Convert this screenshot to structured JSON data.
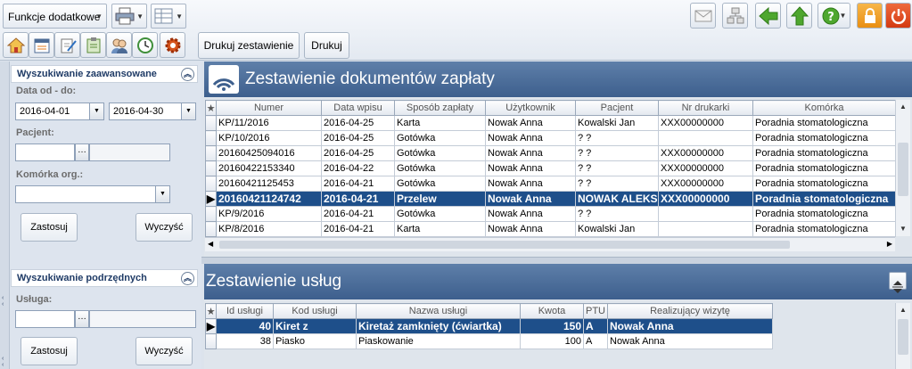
{
  "toolbar": {
    "functions_label": "Funkcje dodatkowe",
    "print_summary_label": "Drukuj zestawienie",
    "print_label": "Drukuj",
    "colors": {
      "green": "#4ea72e",
      "orange": "#f2a01c",
      "red": "#e0451f"
    }
  },
  "left": {
    "advanced_search": {
      "title": "Wyszukiwanie zaawansowane",
      "date_label": "Data od - do:",
      "date_from": "2016-04-01",
      "date_to": "2016-04-30",
      "patient_label": "Pacjent:",
      "patient_value": "",
      "unit_label": "Komórka org.:",
      "unit_value": "",
      "apply_label": "Zastosuj",
      "clear_label": "Wyczyść"
    },
    "sub_search": {
      "title": "Wyszukiwanie podrzędnych",
      "service_label": "Usługa:",
      "service_value": "",
      "apply_label": "Zastosuj",
      "clear_label": "Wyczyść"
    }
  },
  "payments": {
    "title": "Zestawienie dokumentów zapłaty",
    "columns": [
      "Numer",
      "Data wpisu",
      "Sposób zapłaty",
      "Użytkownik",
      "Pacjent",
      "Nr drukarki",
      "Komórka"
    ],
    "rows": [
      [
        "KP/11/2016",
        "2016-04-25",
        "Karta",
        "Nowak Anna",
        "Kowalski Jan",
        "XXX00000000",
        "Poradnia stomatologiczna"
      ],
      [
        "KP/10/2016",
        "2016-04-25",
        "Gotówka",
        "Nowak Anna",
        "? ?",
        "",
        "Poradnia stomatologiczna"
      ],
      [
        "20160425094016",
        "2016-04-25",
        "Gotówka",
        "Nowak Anna",
        "? ?",
        "XXX00000000",
        "Poradnia stomatologiczna"
      ],
      [
        "20160422153340",
        "2016-04-22",
        "Gotówka",
        "Nowak Anna",
        "? ?",
        "XXX00000000",
        "Poradnia stomatologiczna"
      ],
      [
        "20160421125453",
        "2016-04-21",
        "Gotówka",
        "Nowak Anna",
        "? ?",
        "XXX00000000",
        "Poradnia stomatologiczna"
      ],
      [
        "20160421124742",
        "2016-04-21",
        "Przelew",
        "Nowak Anna",
        "NOWAK ALEKS...",
        "XXX00000000",
        "Poradnia stomatologiczna"
      ],
      [
        "KP/9/2016",
        "2016-04-21",
        "Gotówka",
        "Nowak Anna",
        "? ?",
        "",
        "Poradnia stomatologiczna"
      ],
      [
        "KP/8/2016",
        "2016-04-21",
        "Karta",
        "Nowak Anna",
        "Kowalski Jan",
        "",
        "Poradnia stomatologiczna"
      ]
    ],
    "selected_row": 5
  },
  "services": {
    "title": "Zestawienie usług",
    "columns": [
      "Id usługi",
      "Kod usługi",
      "Nazwa usługi",
      "Kwota",
      "PTU",
      "Realizujący wizytę"
    ],
    "rows": [
      [
        "40",
        "Kiret z",
        "Kiretaż zamknięty (ćwiartka)",
        "150",
        "A",
        "Nowak Anna"
      ],
      [
        "38",
        "Piasko",
        "Piaskowanie",
        "100",
        "A",
        "Nowak Anna"
      ]
    ],
    "selected_row": 0
  }
}
